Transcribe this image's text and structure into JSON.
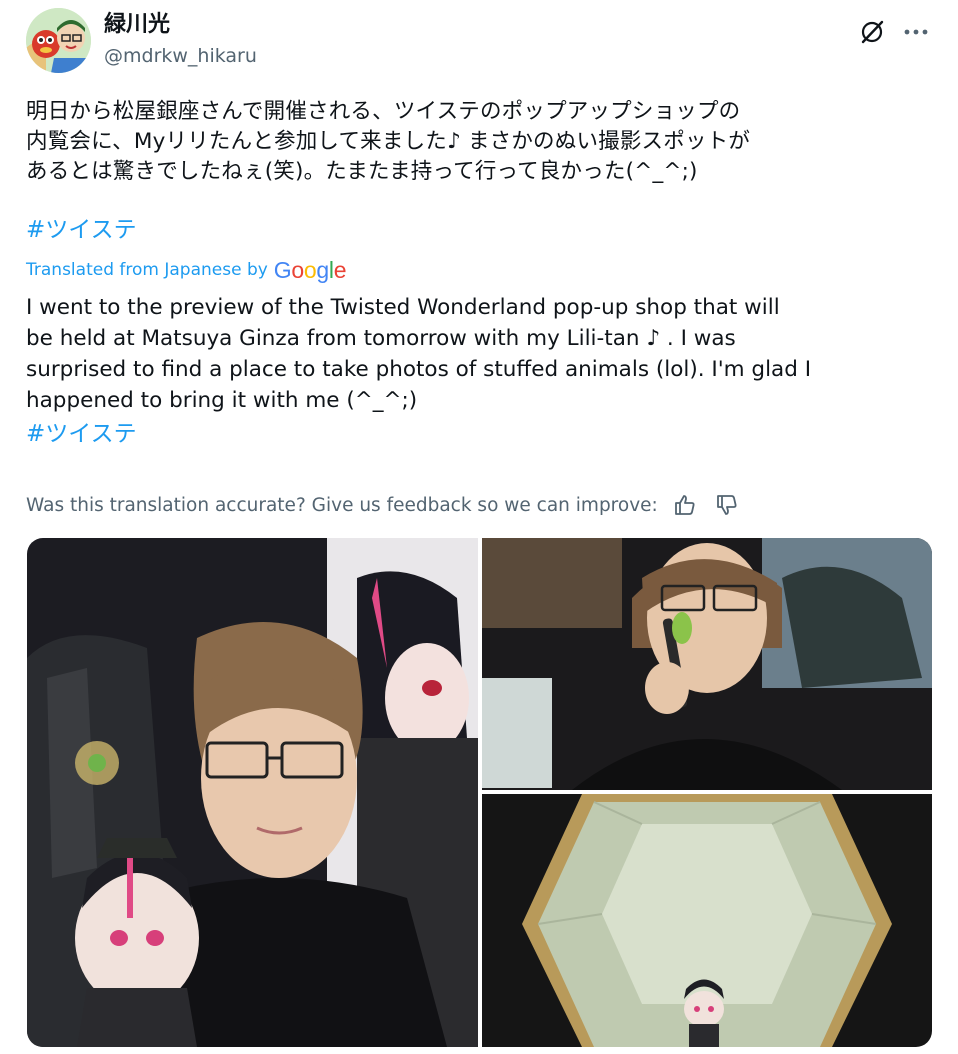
{
  "author": {
    "display_name": "緑川光",
    "handle": "@mdrkw_hikaru"
  },
  "icons": {
    "avatar": "avatar-illustration",
    "grok": "grok-slash-icon",
    "more": "more-horizontal-icon",
    "thumbs_up": "thumbs-up-icon",
    "thumbs_down": "thumbs-down-icon"
  },
  "tweet": {
    "original_lines": [
      "明日から松屋銀座さんで開催される、ツイステのポップアップショップの",
      "内覧会に、Myリリたんと参加して来ました♪ まさかのぬい撮影スポットが",
      "あるとは驚きでしたねぇ(笑)。たまたま持って行って良かった(^_^;)"
    ],
    "hashtag": "#ツイステ",
    "translated_label": "Translated from Japanese by",
    "translation_provider": "Google",
    "translation_lines": [
      "I went to the preview of the Twisted Wonderland pop-up shop that will",
      "be held at Matsuya Ginza from tomorrow with my Lili-tan ♪ . I was",
      "surprised to find a place to take photos of stuffed animals (lol). I'm glad I",
      "happened to bring it with me (^_^;)"
    ],
    "translation_hashtag": "#ツイステ"
  },
  "feedback": {
    "prompt": "Was this translation accurate? Give us feedback so we can improve:"
  },
  "colors": {
    "link": "#1d9bf0",
    "secondary_text": "#536471",
    "primary_text": "#0f1419",
    "google_blue": "#4285F4",
    "google_red": "#EA4335",
    "google_yellow": "#FBBC05",
    "google_green": "#34A853"
  }
}
